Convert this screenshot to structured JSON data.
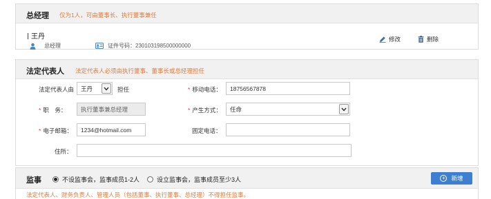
{
  "general_manager": {
    "title": "总经理",
    "note": "仅为1人，可由董事长、执行董事兼任",
    "person": {
      "name": "王丹",
      "role": "总经理",
      "id_label": "证件号码：",
      "id_number": "230103198500000000"
    },
    "actions": {
      "edit": "修改",
      "delete": "删除"
    }
  },
  "legal_representative": {
    "title": "法定代表人",
    "note": "法定代表人必须由执行董事、董事长或总经理担任",
    "fields": {
      "held_by_label": "法定代表人由",
      "held_by_value": "王丹",
      "held_by_suffix": "担任",
      "mobile_label": "移动电话：",
      "mobile_value": "18756567878",
      "position_label": "职　务：",
      "position_value": "执行董事兼总经理",
      "method_label": "产生方式：",
      "method_value": "任命",
      "email_label": "电子邮箱：",
      "email_value": "1234@hotmail.com",
      "phone_label": "固定电话：",
      "phone_value": "",
      "address_label": "住所：",
      "address_value": ""
    }
  },
  "supervisor": {
    "title": "监事",
    "option1": "不设监事会，监事成员1-2人",
    "option2": "设立监事会，监事成员至少3人",
    "selected": 1,
    "add_button": "新增",
    "note": "法定代表人、财务负责人、管理人员（包括董事、执行董事、总经理）不得担任监事。"
  },
  "colors": {
    "accent": "#3d7fd0",
    "note": "#e57a3b",
    "required": "#e0393e"
  }
}
